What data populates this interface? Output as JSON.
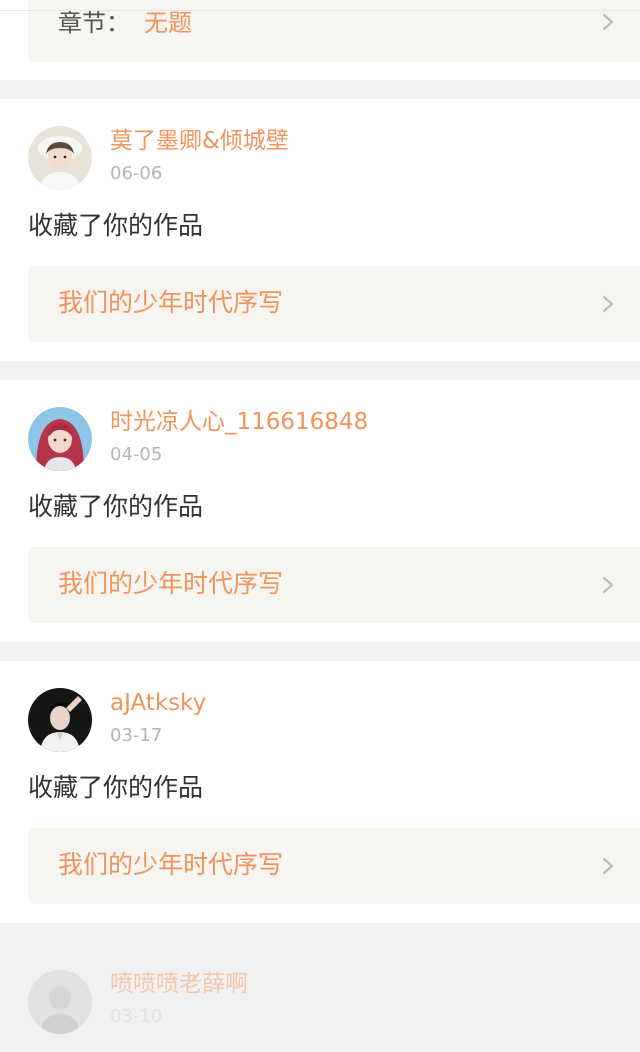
{
  "top_item": {
    "label": "章节：",
    "value": "无题"
  },
  "notifications": [
    {
      "username": "莫了墨卿&倾城壁",
      "date": "06-06",
      "action": "收藏了你的作品",
      "work_title": "我们的少年时代序写",
      "avatar": "avatar-girl-white-hat"
    },
    {
      "username": "时光凉人心_116616848",
      "date": "04-05",
      "action": "收藏了你的作品",
      "work_title": "我们的少年时代序写",
      "avatar": "avatar-girl-red-hair"
    },
    {
      "username": "aJAtksky",
      "date": "03-17",
      "action": "收藏了你的作品",
      "work_title": "我们的少年时代序写",
      "avatar": "avatar-boy-dark"
    },
    {
      "username": "喷喷喷老薛啊",
      "date": "03-10",
      "avatar": "avatar-person-gray"
    }
  ],
  "colors": {
    "accent": "#f0935d",
    "text_main": "#333333",
    "text_date": "#b5b5b5",
    "work_box_bg": "#f6f5f0",
    "page_bg": "#f1f1f1"
  },
  "icons": {
    "chevron": "chevron-right-icon"
  }
}
